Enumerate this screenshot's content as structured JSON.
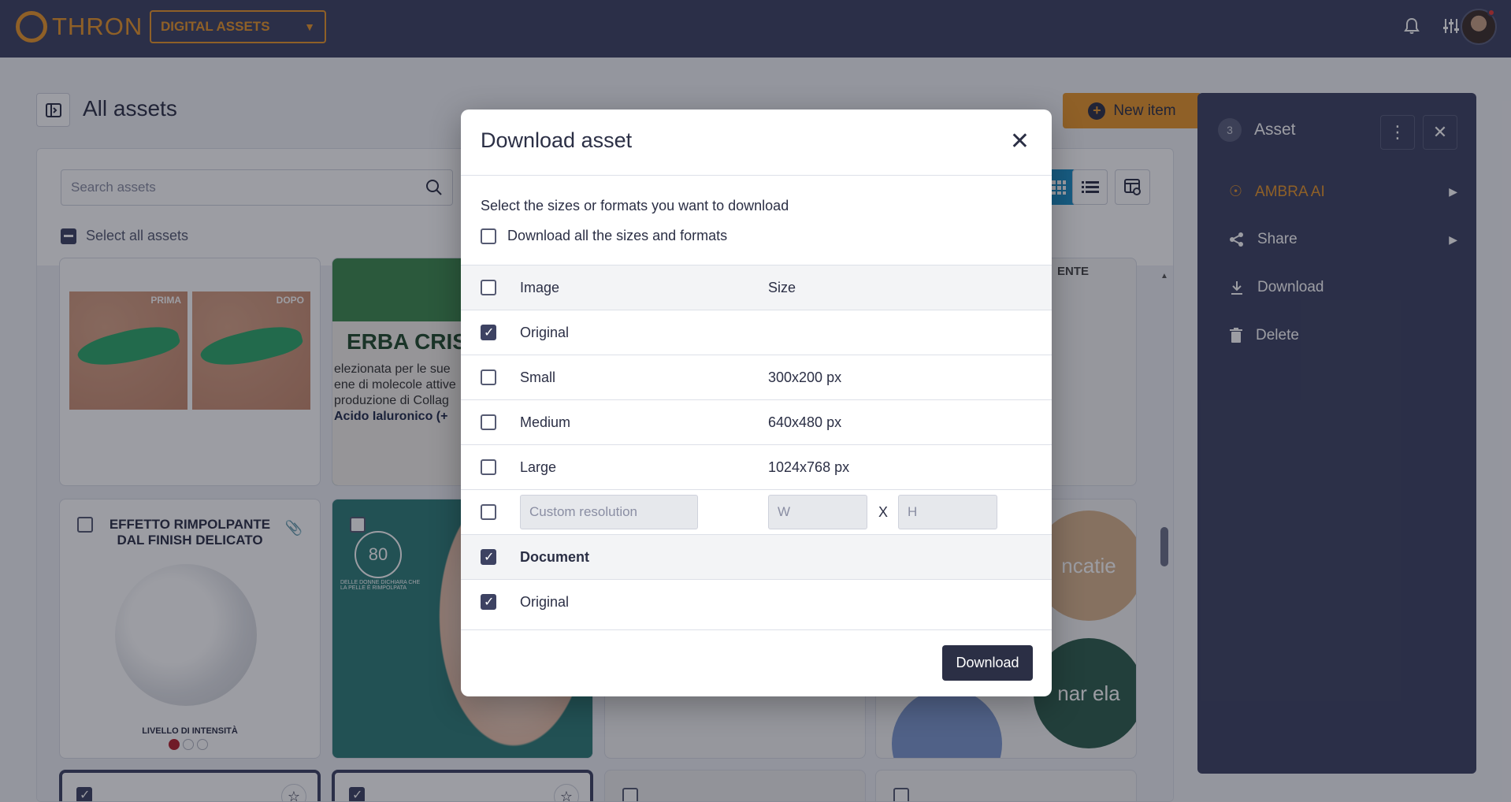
{
  "topbar": {
    "logo_text": "THRON",
    "workspace_selector": "DIGITAL ASSETS",
    "icons": [
      "bell-icon",
      "sliders-icon"
    ]
  },
  "page": {
    "title": "All assets",
    "new_item_label": "New item"
  },
  "assets": {
    "search_placeholder": "Search assets",
    "select_all_label": "Select all assets",
    "cards": [
      {
        "labels": [
          "PRIMA",
          "DOPO"
        ]
      },
      {
        "headline": "ERBA CRIS",
        "lines": [
          "elezionata per le sue",
          "ene di molecole attive",
          "produzione di Collag",
          "Acido Ialuronico (+"
        ]
      },
      {
        "fragment": "ENTE"
      },
      {
        "headline": "EFFETTO RIMPOLPANTE DAL FINISH DELICATO",
        "caption": "LIVELLO DI INTENSITÀ"
      },
      {
        "stat": "80",
        "stat_unit": "%",
        "caption": "DELLE DONNE DICHIARA CHE LA PELLE È RIMPOLPATA"
      },
      {
        "brand_top": "ncatie",
        "brand_bottom": "nar ela"
      }
    ]
  },
  "right_panel": {
    "count": "3",
    "title": "Asset",
    "items": [
      {
        "label": "AMBRA AI",
        "has_arrow": true
      },
      {
        "label": "Share",
        "has_arrow": true
      },
      {
        "label": "Download",
        "has_arrow": false
      },
      {
        "label": "Delete",
        "has_arrow": false
      }
    ]
  },
  "modal": {
    "title": "Download asset",
    "instruction": "Select the sizes or formats you want to download",
    "download_all_label": "Download all the sizes and formats",
    "image_header": "Image",
    "size_header": "Size",
    "image_rows": [
      {
        "label": "Original",
        "size": "",
        "checked": true
      },
      {
        "label": "Small",
        "size": "300x200 px",
        "checked": false
      },
      {
        "label": "Medium",
        "size": "640x480 px",
        "checked": false
      },
      {
        "label": "Large",
        "size": "1024x768 px",
        "checked": false
      }
    ],
    "custom_placeholder": "Custom resolution",
    "w_placeholder": "W",
    "h_placeholder": "H",
    "x_label": "X",
    "document_header": "Document",
    "document_rows": [
      {
        "label": "Original",
        "checked": true
      }
    ],
    "download_button": "Download"
  }
}
